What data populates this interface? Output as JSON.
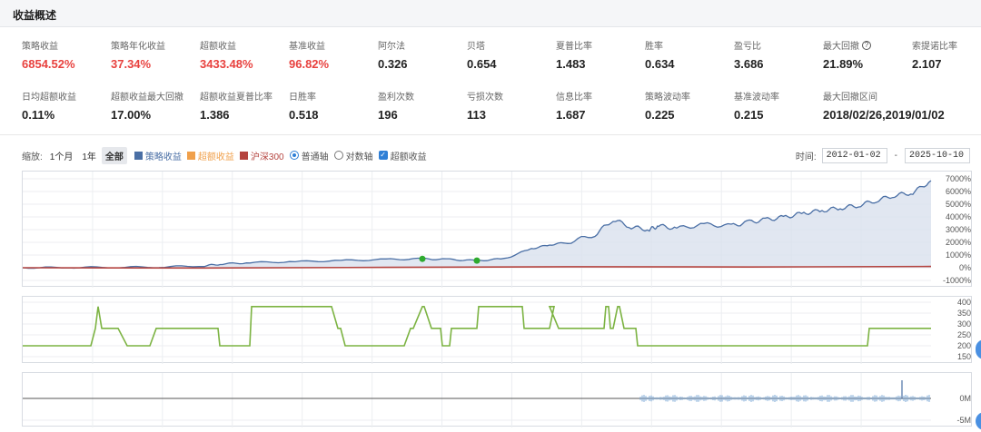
{
  "header": {
    "title": "收益概述"
  },
  "stats": [
    {
      "label": "策略收益",
      "value": "6854.52%",
      "red": true
    },
    {
      "label": "策略年化收益",
      "value": "37.34%",
      "red": true
    },
    {
      "label": "超额收益",
      "value": "3433.48%",
      "red": true
    },
    {
      "label": "基准收益",
      "value": "96.82%",
      "red": true
    },
    {
      "label": "阿尔法",
      "value": "0.326"
    },
    {
      "label": "贝塔",
      "value": "0.654"
    },
    {
      "label": "夏普比率",
      "value": "1.483"
    },
    {
      "label": "胜率",
      "value": "0.634"
    },
    {
      "label": "盈亏比",
      "value": "3.686"
    },
    {
      "label": "最大回撤",
      "value": "21.89%",
      "help": true
    },
    {
      "label": "索提诺比率",
      "value": "2.107"
    },
    {
      "label": "日均超额收益",
      "value": "0.11%"
    },
    {
      "label": "超额收益最大回撤",
      "value": "17.00%"
    },
    {
      "label": "超额收益夏普比率",
      "value": "1.386"
    },
    {
      "label": "日胜率",
      "value": "0.518"
    },
    {
      "label": "盈利次数",
      "value": "196"
    },
    {
      "label": "亏损次数",
      "value": "113"
    },
    {
      "label": "信息比率",
      "value": "1.687"
    },
    {
      "label": "策略波动率",
      "value": "0.225"
    },
    {
      "label": "基准波动率",
      "value": "0.215"
    },
    {
      "label": "最大回撤区间",
      "value": "2018/02/26,2019/01/02"
    }
  ],
  "toolbar": {
    "zoom_label": "缩放:",
    "zoom_1m": "1个月",
    "zoom_1y": "1年",
    "zoom_all": "全部",
    "legend_strategy": "策略收益",
    "legend_excess": "超额收益",
    "legend_benchmark": "沪深300",
    "axis_normal": "普通轴",
    "axis_log": "对数轴",
    "toggle_excess": "超额收益"
  },
  "time": {
    "label": "时间:",
    "start": "2012-01-02",
    "end": "2025-10-10",
    "sep": "-"
  },
  "colors": {
    "strategy": "#4a6fa5",
    "strategy_fill": "#d9e1ee",
    "excess": "#f0a04b",
    "benchmark": "#b5443f",
    "position": "#7cb342",
    "accent": "#2f7fd6",
    "red": "#e8423f"
  },
  "chart_data": [
    {
      "type": "area",
      "title": "",
      "series": [
        {
          "name": "策略收益",
          "x": [
            0,
            0.05,
            0.1,
            0.15,
            0.2,
            0.22,
            0.25,
            0.3,
            0.35,
            0.4,
            0.44,
            0.47,
            0.5,
            0.53,
            0.56,
            0.58,
            0.6,
            0.63,
            0.65,
            0.67,
            0.69,
            0.7,
            0.72,
            0.75,
            0.78,
            0.8,
            0.82,
            0.84,
            0.86,
            0.88,
            0.9,
            0.92,
            0.94,
            0.96,
            0.98,
            1.0
          ],
          "values": [
            0,
            20,
            40,
            60,
            150,
            300,
            400,
            480,
            560,
            650,
            700,
            650,
            560,
            700,
            1500,
            1800,
            2000,
            2600,
            3800,
            3200,
            3000,
            3300,
            3100,
            3400,
            3300,
            3600,
            3800,
            4000,
            4300,
            4500,
            4700,
            4900,
            5300,
            5700,
            5900,
            6854
          ]
        },
        {
          "name": "沪深300",
          "x": [
            0,
            0.2,
            0.4,
            0.6,
            0.8,
            1.0
          ],
          "values": [
            0,
            -20,
            30,
            80,
            60,
            97
          ]
        }
      ],
      "markers": [
        {
          "x": 0.44,
          "value": 700
        },
        {
          "x": 0.5,
          "value": 560
        }
      ],
      "yticks": [
        "7000%",
        "6000%",
        "5000%",
        "4000%",
        "3000%",
        "2000%",
        "1000%",
        "0%",
        "-1000%"
      ],
      "ylim": [
        -1000,
        7000
      ]
    },
    {
      "type": "line",
      "title": "",
      "series": [
        {
          "name": "",
          "x": [
            0,
            0.075,
            0.08,
            0.083,
            0.087,
            0.105,
            0.115,
            0.117,
            0.14,
            0.147,
            0.15,
            0.215,
            0.217,
            0.25,
            0.252,
            0.34,
            0.347,
            0.35,
            0.355,
            0.357,
            0.42,
            0.427,
            0.43,
            0.44,
            0.44,
            0.442,
            0.45,
            0.46,
            0.462,
            0.47,
            0.472,
            0.5,
            0.502,
            0.55,
            0.552,
            0.58,
            0.585,
            0.58,
            0.59,
            0.595,
            0.64,
            0.642,
            0.645,
            0.647,
            0.65,
            0.655,
            0.657,
            0.662,
            0.675,
            0.677,
            0.7,
            0.702,
            0.93,
            0.932,
            1.0
          ],
          "values": [
            200,
            200,
            280,
            380,
            280,
            280,
            200,
            200,
            200,
            280,
            280,
            280,
            200,
            200,
            380,
            380,
            280,
            280,
            200,
            200,
            200,
            280,
            280,
            380,
            380,
            380,
            280,
            280,
            200,
            200,
            280,
            280,
            380,
            380,
            280,
            280,
            380,
            380,
            280,
            280,
            280,
            380,
            380,
            280,
            280,
            380,
            380,
            280,
            280,
            200,
            200,
            200,
            200,
            280,
            280
          ]
        }
      ],
      "yticks": [
        "400",
        "350",
        "300",
        "250",
        "200",
        "150"
      ],
      "ylim": [
        150,
        400
      ]
    },
    {
      "type": "bar",
      "title": "",
      "yticks": [
        "0M",
        "-5M"
      ]
    }
  ]
}
